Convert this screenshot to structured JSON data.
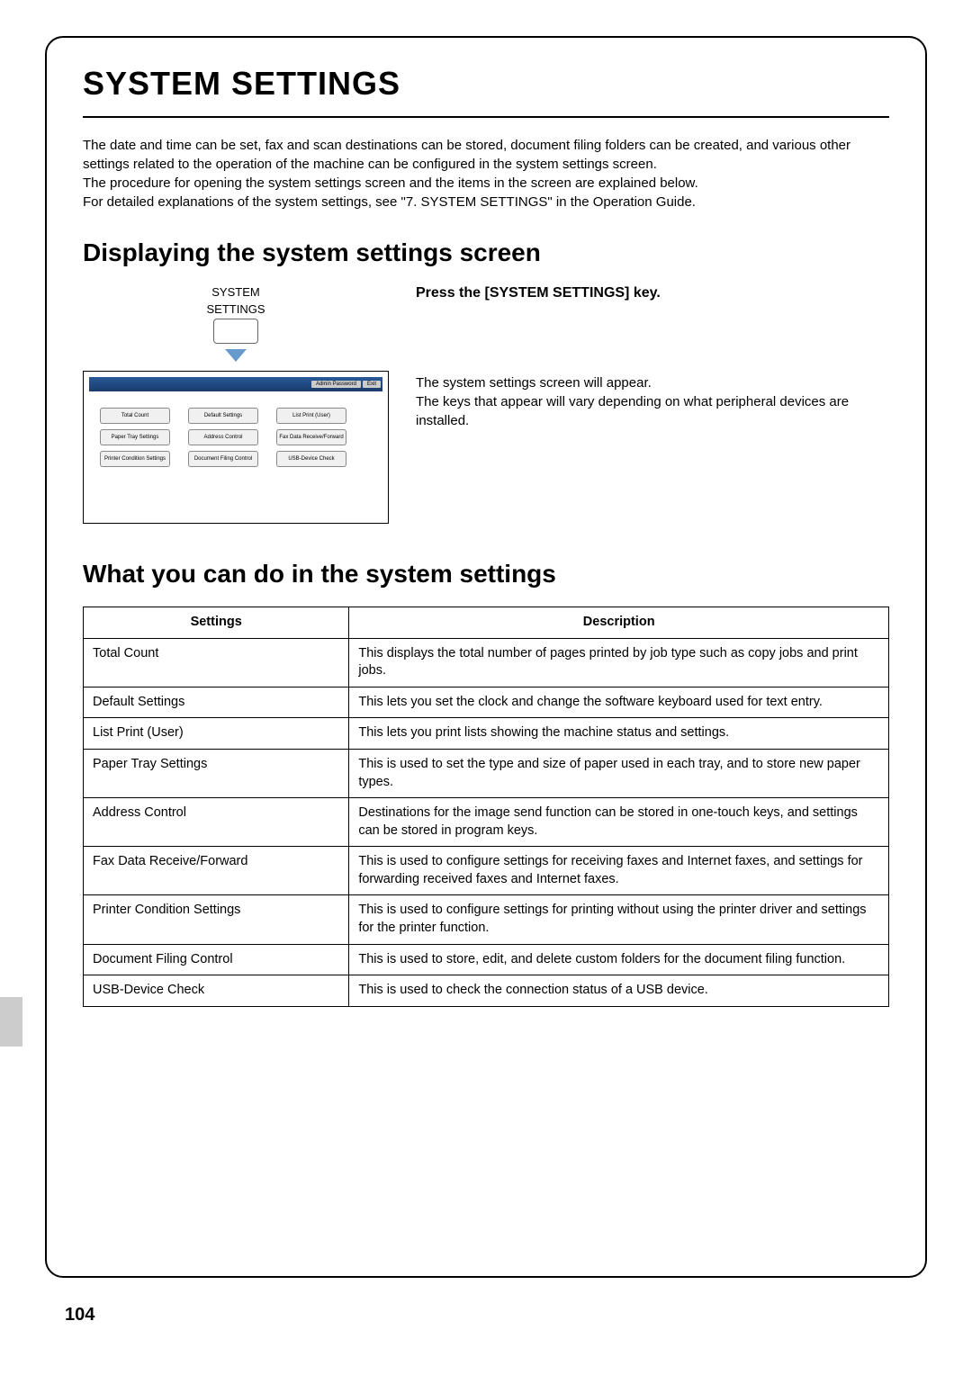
{
  "title": "SYSTEM SETTINGS",
  "intro": {
    "p1": "The date and time can be set, fax and scan destinations can be stored, document filing folders can be created, and various other settings related to the operation of the machine can be configured in the system settings screen.",
    "p2": "The procedure for opening the system settings screen and the items in the screen are explained below.",
    "p3": "For detailed explanations of the system settings, see \"7. SYSTEM SETTINGS\" in the Operation Guide."
  },
  "section1_heading": "Displaying the system settings screen",
  "key_label_line1": "SYSTEM",
  "key_label_line2": "SETTINGS",
  "screen": {
    "hdr_admin": "Admin Password",
    "hdr_exit": "Exit",
    "buttons": {
      "c1r1": "Total Count",
      "c1r2": "Paper Tray Settings",
      "c1r3": "Printer Condition Settings",
      "c2r1": "Default Settings",
      "c2r2": "Address Control",
      "c2r3": "Document Filing Control",
      "c3r1": "List Print (User)",
      "c3r2": "Fax Data Receive/Forward",
      "c3r3": "USB-Device Check"
    }
  },
  "step_title": "Press the [SYSTEM SETTINGS] key.",
  "step_body1": "The system settings screen will appear.",
  "step_body2": "The keys that appear will vary depending on what peripheral devices are installed.",
  "section2_heading": "What you can do in the system settings",
  "table": {
    "header_settings": "Settings",
    "header_description": "Description",
    "rows": [
      {
        "s": "Total Count",
        "d": "This displays the total number of pages printed by job type such as copy jobs and print jobs."
      },
      {
        "s": "Default Settings",
        "d": "This lets you set the clock and change the software keyboard used for text entry."
      },
      {
        "s": "List Print (User)",
        "d": "This lets you print lists showing the machine status and settings."
      },
      {
        "s": "Paper Tray Settings",
        "d": "This is used to set the type and size of paper used in each tray, and to store new paper types."
      },
      {
        "s": "Address Control",
        "d": "Destinations for the image send function can be stored in one-touch keys, and settings can be stored in program keys."
      },
      {
        "s": "Fax Data Receive/Forward",
        "d": "This is used to configure settings for receiving faxes and Internet faxes, and settings for forwarding received faxes and Internet faxes."
      },
      {
        "s": "Printer Condition Settings",
        "d": "This is used to configure settings for printing without using the printer driver and settings for the printer function."
      },
      {
        "s": "Document Filing Control",
        "d": "This is used to store, edit, and delete custom folders for the document filing function."
      },
      {
        "s": "USB-Device Check",
        "d": "This is used to check the connection status of a USB device."
      }
    ]
  },
  "page_number": "104"
}
